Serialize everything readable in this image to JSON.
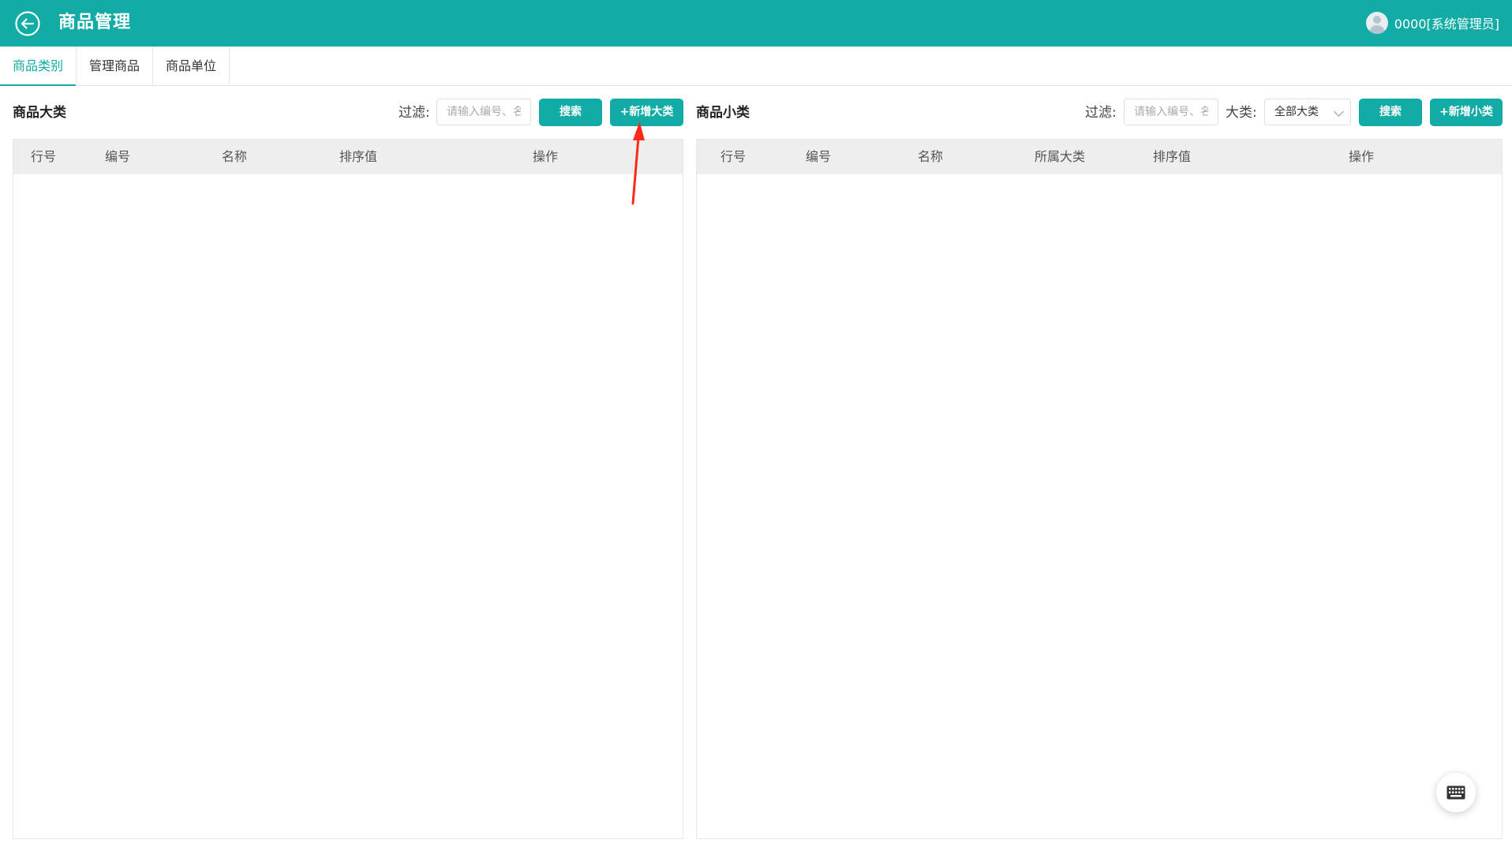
{
  "header": {
    "title": "商品管理",
    "user": "0000[系统管理员]",
    "accent_color": "#12aba6"
  },
  "tabs": [
    {
      "label": "商品类别",
      "active": true
    },
    {
      "label": "管理商品",
      "active": false
    },
    {
      "label": "商品单位",
      "active": false
    }
  ],
  "left_panel": {
    "title": "商品大类",
    "filter_label": "过滤:",
    "filter_placeholder": "请输入编号、名称",
    "search_label": "搜索",
    "add_label": "+新增大类",
    "columns": [
      "行号",
      "编号",
      "名称",
      "排序值",
      "操作"
    ],
    "rows": []
  },
  "right_panel": {
    "title": "商品小类",
    "filter_label": "过滤:",
    "filter_placeholder": "请输入编号、名称",
    "category_label": "大类:",
    "category_selected": "全部大类",
    "search_label": "搜索",
    "add_label": "+新增小类",
    "columns": [
      "行号",
      "编号",
      "名称",
      "所属大类",
      "排序值",
      "操作"
    ],
    "rows": []
  },
  "icons": {
    "back": "back-arrow-icon",
    "avatar": "user-avatar-icon",
    "keyboard": "keyboard-icon",
    "dropdown": "chevron-down-icon"
  },
  "annotation": {
    "type": "arrow",
    "color": "#ff2a1a",
    "points_to": "add-category-button"
  }
}
